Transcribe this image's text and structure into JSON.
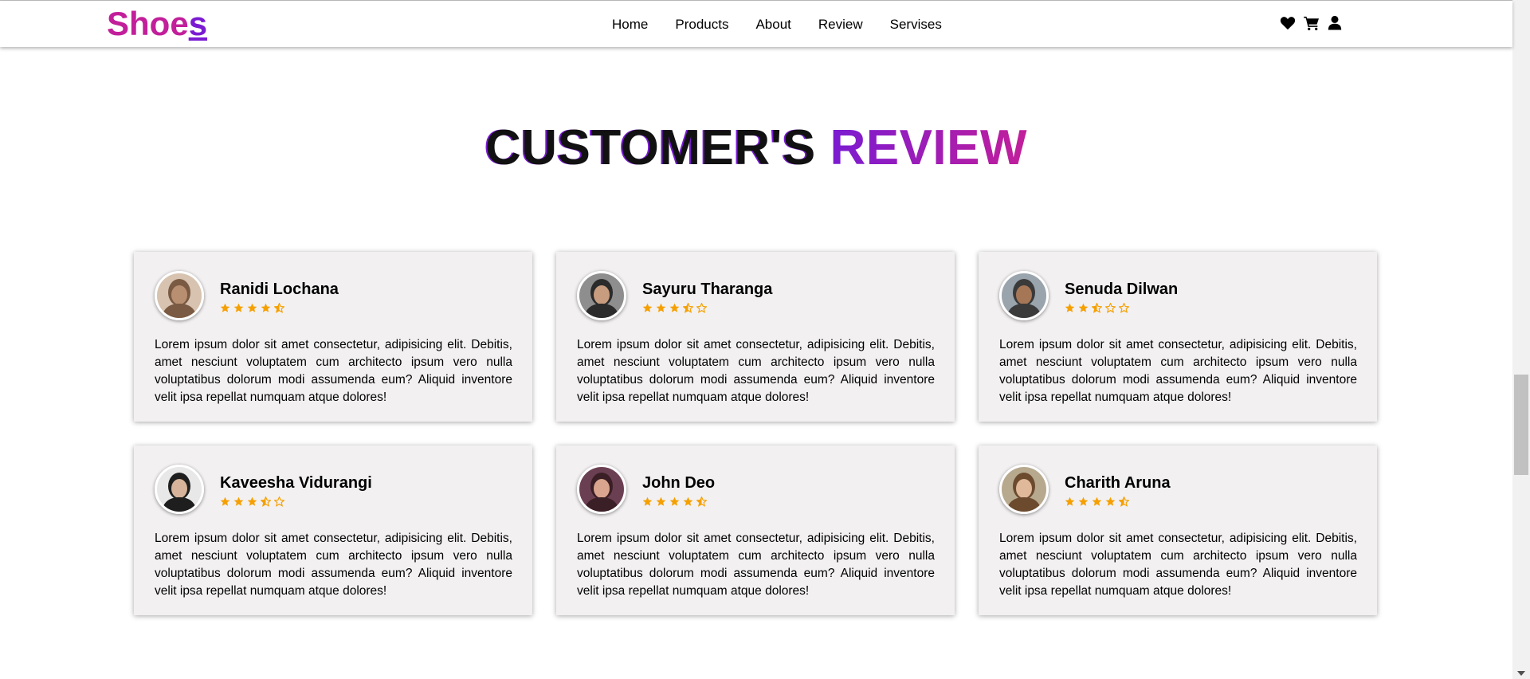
{
  "brand": {
    "logo_main": "Shoe",
    "logo_last": "s"
  },
  "nav": {
    "items": [
      "Home",
      "Products",
      "About",
      "Review",
      "Servises"
    ]
  },
  "header_icons": [
    "heart-icon",
    "cart-icon",
    "user-icon"
  ],
  "section": {
    "title_dark": "CUSTOMER'S",
    "title_accent": "REVIEW"
  },
  "colors": {
    "accent_pink": "#c21f9a",
    "accent_purple": "#7a1bd2",
    "star": "#f5a000",
    "card_bg": "#f2f0f1"
  },
  "reviews": [
    {
      "name": "Ranidi Lochana",
      "rating": 4.5,
      "stars": [
        "full",
        "full",
        "full",
        "full",
        "half"
      ],
      "avatar": [
        "#d7c3b0",
        "#7a5a42",
        "#b98f72"
      ],
      "text": "Lorem ipsum dolor sit amet consectetur, adipisicing elit. Debitis, amet nesciunt voluptatem cum architecto ipsum vero nulla voluptatibus dolorum modi assumenda eum? Aliquid inventore velit ipsa repellat numquam atque dolores!"
    },
    {
      "name": "Sayuru Tharanga",
      "rating": 3.5,
      "stars": [
        "full",
        "full",
        "full",
        "half",
        "empty"
      ],
      "avatar": [
        "#8e8e8e",
        "#2b2b2b",
        "#c89c7e"
      ],
      "text": "Lorem ipsum dolor sit amet consectetur, adipisicing elit. Debitis, amet nesciunt voluptatem cum architecto ipsum vero nulla voluptatibus dolorum modi assumenda eum? Aliquid inventore velit ipsa repellat numquam atque dolores!"
    },
    {
      "name": "Senuda Dilwan",
      "rating": 2.5,
      "stars": [
        "full",
        "full",
        "half",
        "empty",
        "empty"
      ],
      "avatar": [
        "#9aa4ad",
        "#3a3a3a",
        "#a67757"
      ],
      "text": "Lorem ipsum dolor sit amet consectetur, adipisicing elit. Debitis, amet nesciunt voluptatem cum architecto ipsum vero nulla voluptatibus dolorum modi assumenda eum? Aliquid inventore velit ipsa repellat numquam atque dolores!"
    },
    {
      "name": "Kaveesha Vidurangi",
      "rating": 3.5,
      "stars": [
        "full",
        "full",
        "full",
        "half",
        "empty"
      ],
      "avatar": [
        "#e8e8e8",
        "#1e1e1e",
        "#d6b39a"
      ],
      "text": "Lorem ipsum dolor sit amet consectetur, adipisicing elit. Debitis, amet nesciunt voluptatem cum architecto ipsum vero nulla voluptatibus dolorum modi assumenda eum? Aliquid inventore velit ipsa repellat numquam atque dolores!"
    },
    {
      "name": "John Deo",
      "rating": 4.5,
      "stars": [
        "full",
        "full",
        "full",
        "full",
        "half"
      ],
      "avatar": [
        "#6b3f52",
        "#3b1f26",
        "#d9a58e"
      ],
      "text": "Lorem ipsum dolor sit amet consectetur, adipisicing elit. Debitis, amet nesciunt voluptatem cum architecto ipsum vero nulla voluptatibus dolorum modi assumenda eum? Aliquid inventore velit ipsa repellat numquam atque dolores!"
    },
    {
      "name": "Charith Aruna",
      "rating": 4.5,
      "stars": [
        "full",
        "full",
        "full",
        "full",
        "half"
      ],
      "avatar": [
        "#b7a98e",
        "#6b4a2e",
        "#e0b89a"
      ],
      "text": "Lorem ipsum dolor sit amet consectetur, adipisicing elit. Debitis, amet nesciunt voluptatem cum architecto ipsum vero nulla voluptatibus dolorum modi assumenda eum? Aliquid inventore velit ipsa repellat numquam atque dolores!"
    }
  ]
}
